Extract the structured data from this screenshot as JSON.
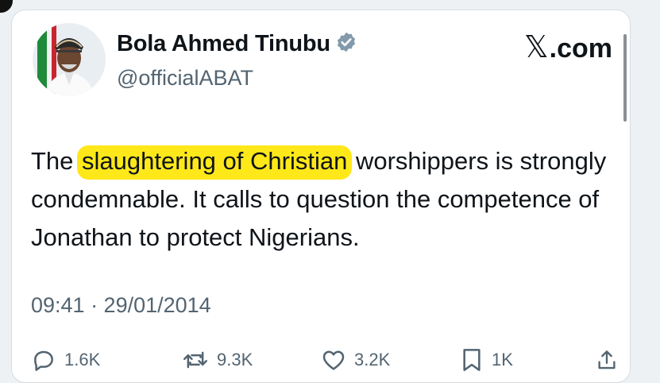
{
  "tweet": {
    "author": {
      "display_name": "Bola Ahmed Tinubu",
      "handle": "@officialABAT",
      "verified_icon": "verified-badge-icon"
    },
    "brand": {
      "x_glyph": "𝕏",
      "suffix": ".com"
    },
    "text": {
      "before": "The ",
      "highlighted": "slaughtering of Christian",
      "after": " worshippers  is strongly condemnable. It calls to question the competence of Jonathan to protect Nigerians."
    },
    "highlight_color": "#ffe81a",
    "timestamp": "09:41 · 29/01/2014",
    "actions": {
      "replies": "1.6K",
      "retweets": "9.3K",
      "likes": "3.2K",
      "bookmarks": "1K"
    },
    "colors": {
      "verified": "#829aab",
      "text": "#0f1419",
      "secondary": "#536471"
    }
  }
}
